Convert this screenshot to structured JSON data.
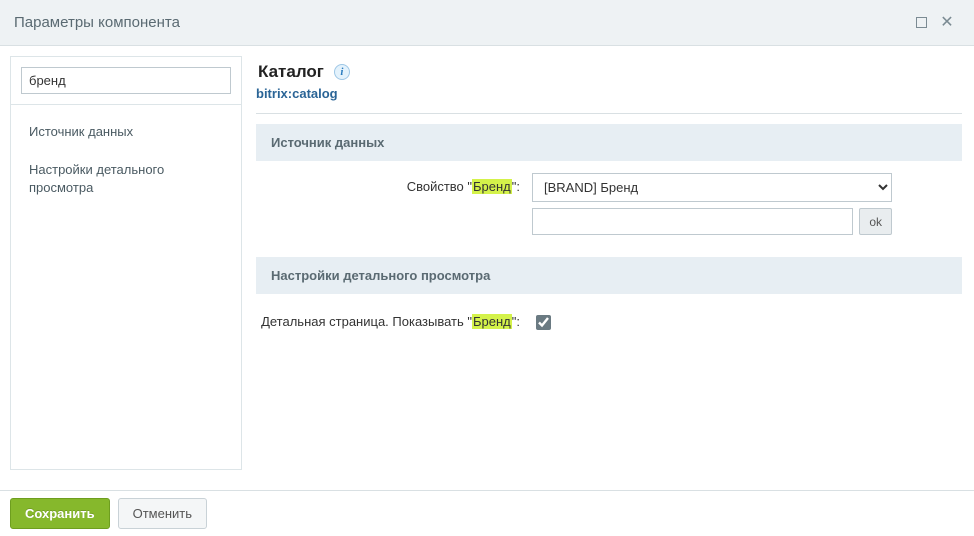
{
  "window": {
    "title": "Параметры компонента"
  },
  "sidebar": {
    "search_value": "бренд",
    "items": [
      {
        "label": "Источник данных"
      },
      {
        "label": "Настройки детального просмотра"
      }
    ]
  },
  "component": {
    "title": "Каталог",
    "code": "bitrix:catalog"
  },
  "sections": {
    "datasource": {
      "title": "Источник данных",
      "brand_property": {
        "label_pre": "Свойство \"",
        "label_hl": "Бренд",
        "label_post": "\":",
        "select_value": "[BRAND] Бренд",
        "text_value": "",
        "ok_label": "ok"
      }
    },
    "detail": {
      "title": "Настройки детального просмотра",
      "show_brand": {
        "label_pre": "Детальная страница. Показывать \"",
        "label_hl": "Бренд",
        "label_post": "\":",
        "checked": true
      }
    }
  },
  "footer": {
    "save": "Сохранить",
    "cancel": "Отменить"
  }
}
